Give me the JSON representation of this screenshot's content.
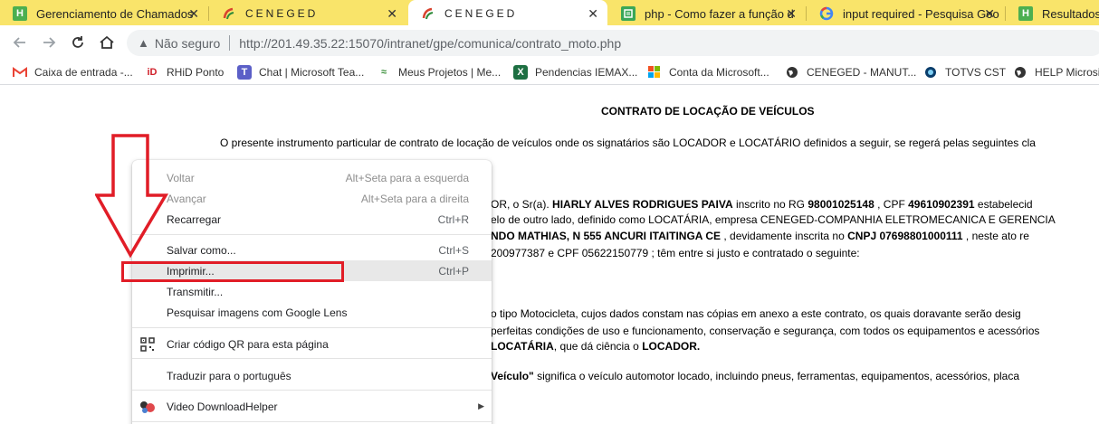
{
  "tabs": [
    {
      "title": "Gerenciamento de Chamados",
      "icon": "h-green-icon",
      "active": false
    },
    {
      "title": "CENEGED",
      "icon": "ceneged-logo-icon",
      "active": false
    },
    {
      "title": "CENEGED",
      "icon": "ceneged-logo-icon",
      "active": true
    },
    {
      "title": "php - Como fazer a função d",
      "icon": "stackoverflow-icon",
      "active": false
    },
    {
      "title": "input required - Pesquisa Goo",
      "icon": "google-icon",
      "active": false
    },
    {
      "title": "Resultados d",
      "icon": "h-green-icon",
      "active": false
    }
  ],
  "omnibox": {
    "security": "Não seguro",
    "url": "http://201.49.35.22:15070/intranet/gpe/comunica/contrato_moto.php"
  },
  "bookmarks": [
    {
      "label": "Caixa de entrada -...",
      "icon": "gmail-icon"
    },
    {
      "label": "RHiD Ponto",
      "icon": "rhid-icon"
    },
    {
      "label": "Chat | Microsoft Tea...",
      "icon": "teams-icon"
    },
    {
      "label": "Meus Projetos | Me...",
      "icon": "projects-icon"
    },
    {
      "label": "Pendencias IEMAX...",
      "icon": "excel-icon"
    },
    {
      "label": "Conta da Microsoft...",
      "icon": "microsoft-icon"
    },
    {
      "label": "CENEGED - MANUT...",
      "icon": "globe-icon"
    },
    {
      "label": "TOTVS CST",
      "icon": "totvs-icon"
    },
    {
      "label": "HELP Microsig",
      "icon": "globe-icon"
    }
  ],
  "doc": {
    "title": "CONTRATO DE LOCAÇÃO DE VEÍCULOS",
    "intro": "O presente instrumento particular de contrato de locação de veículos onde os signatários são LOCADOR e LOCATÁRIO definidos a seguir, se regerá pelas seguintes cla",
    "l1a": "OR, o Sr(a).",
    "l1b": "HIARLY ALVES RODRIGUES PAIVA",
    "l1c": "inscrito no RG",
    "l1d": "98001025148",
    "l1e": ", CPF",
    "l1f": "49610902391",
    "l1g": "estabelecid",
    "l2": "elo de outro lado, definido como LOCATÁRIA, empresa CENEGED-COMPANHIA ELETROMECANICA E GERENCIA",
    "l3a": "NDO MATHIAS, N 555 ANCURI ITAITINGA CE",
    "l3b": ", devidamente inscrita no",
    "l3c": "CNPJ 07698801000111",
    "l3d": ", neste ato re",
    "l4": "200977387 e CPF 05622150779 ; têm entre si justo e contratado o seguinte:",
    "l5": "o tipo Motocicleta, cujos dados constam nas cópias em anexo a este contrato, os quais doravante serão desig",
    "l6": "perfeitas condições de uso e funcionamento, conservação e segurança, com todos os equipamentos e acessórios",
    "l7a": "LOCATÁRIA",
    "l7b": ", que dá ciência o",
    "l7c": "LOCADOR.",
    "l8a": "Veículo\"",
    "l8b": "significa o veículo automotor locado, incluindo pneus, ferramentas, equipamentos, acessórios, placa"
  },
  "menu": {
    "back": {
      "label": "Voltar",
      "shortcut": "Alt+Seta para a esquerda"
    },
    "forward": {
      "label": "Avançar",
      "shortcut": "Alt+Seta para a direita"
    },
    "reload": {
      "label": "Recarregar",
      "shortcut": "Ctrl+R"
    },
    "save": {
      "label": "Salvar como...",
      "shortcut": "Ctrl+S"
    },
    "print": {
      "label": "Imprimir...",
      "shortcut": "Ctrl+P"
    },
    "cast": {
      "label": "Transmitir..."
    },
    "lens": {
      "label": "Pesquisar imagens com Google Lens"
    },
    "qr": {
      "label": "Criar código QR para esta página"
    },
    "translate": {
      "label": "Traduzir para o português"
    },
    "downloadhelper": {
      "label": "Video DownloadHelper"
    }
  },
  "colors": {
    "tabstrip": "#f9e46a",
    "annotation": "#e11d27",
    "menu_highlight": "#e8e8e8"
  }
}
